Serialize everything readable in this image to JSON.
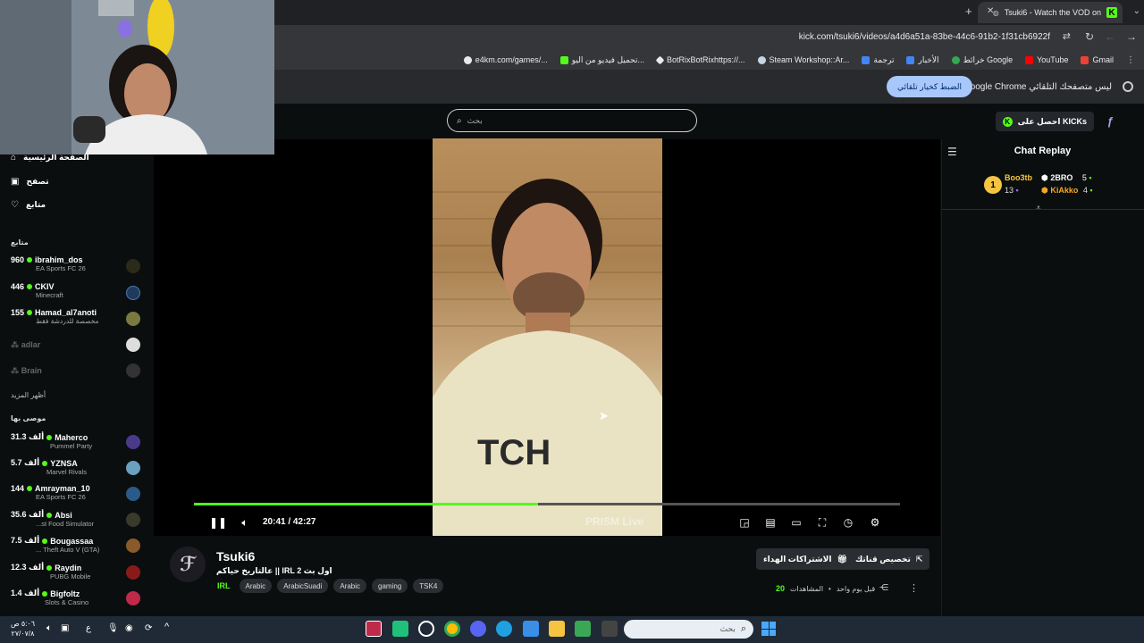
{
  "browser": {
    "tab_title": "Tsuki6 - Watch the VOD on",
    "url": "kick.com/tsuki6/videos/a4d6a51a-83be-44c6-91b2-1f31cb6922f",
    "bookmarks": [
      {
        "label": "Gmail",
        "color": "#ea4335"
      },
      {
        "label": "YouTube",
        "color": "#ff0000"
      },
      {
        "label": "خرائط Google",
        "color": "#34a853"
      },
      {
        "label": "الأخبار",
        "color": "#4285f4"
      },
      {
        "label": "ترجمة",
        "color": "#4285f4"
      },
      {
        "label": "Steam Workshop::Ar...",
        "color": "#c7d5e0"
      },
      {
        "label": "BotRixBotRixhttps://...",
        "color": "#e8eaed"
      },
      {
        "label": "تحميل فيديو من اليو...",
        "color": "#53fc18"
      },
      {
        "label": "e4km.com/games/...",
        "color": "#e8eaed"
      }
    ],
    "infobar_text": "Google Chrome ليس متصفحك التلقائي",
    "infobar_button": "الضبط كخيار تلقائي"
  },
  "kick": {
    "search_placeholder": "بحث",
    "kicks_button": "احصل على KICKs",
    "nav": [
      {
        "label": "الصفحة الرئيسية",
        "icon": "home-icon"
      },
      {
        "label": "تصفح",
        "icon": "browse-icon"
      },
      {
        "label": "متابع",
        "icon": "heart-icon"
      }
    ],
    "following_title": "متابع",
    "following": [
      {
        "count": "960",
        "name": "ibrahim_dos",
        "game": "EA Sports FC 26",
        "live": true
      },
      {
        "count": "446",
        "name": "CKIV",
        "game": "Minecraft",
        "live": true
      },
      {
        "count": "155",
        "name": "Hamad_al7anoti",
        "game": "مخصصة للدردشة فقط",
        "live": true
      },
      {
        "count": "",
        "name": "adlar",
        "game": "",
        "live": false
      },
      {
        "count": "",
        "name": "Brain",
        "game": "",
        "live": false
      }
    ],
    "show_more": "أظهر المزيد",
    "recommended_title": "موصى بها",
    "recommended": [
      {
        "count": "31.3 ألف",
        "name": "Maherco",
        "game": "Pummel Party"
      },
      {
        "count": "5.7 ألف",
        "name": "YZNSA",
        "game": "Marvel Rivals"
      },
      {
        "count": "144",
        "name": "Amrayman_10",
        "game": "EA Sports FC 26"
      },
      {
        "count": "35.6 ألف",
        "name": "Absi",
        "game": "...st Food Simulator"
      },
      {
        "count": "7.5 ألف",
        "name": "Bougassaa",
        "game": "... Theft Auto V (GTA)"
      },
      {
        "count": "12.3 ألف",
        "name": "Raydin",
        "game": "PUBG Mobile"
      },
      {
        "count": "1.4 ألف",
        "name": "Bigfoltz",
        "game": "Slots & Casino"
      }
    ],
    "player": {
      "time": "20:41 / 42:27",
      "progress": 0.487,
      "watermark": "PRISM Live"
    },
    "stream": {
      "streamer": "Tsuki6",
      "title": "عالتاريخ حياكم || IRL 2 اول بث",
      "category": "IRL",
      "tags": [
        "Arabic",
        "ArabicSuadi",
        "Arabic",
        "gaming",
        "TSK4"
      ],
      "customize_button": "تخصيص قناتك",
      "gift_button": "الاشتراكات الهداء",
      "views_label": "المشاهدات",
      "views_count": "20",
      "posted": "قبل يوم واحد"
    },
    "chat": {
      "title": "Chat Replay",
      "leaderboard": [
        {
          "name": "2BRO",
          "value": "5",
          "color": "#ffffff"
        },
        {
          "name": "Boo3tb",
          "value": "13",
          "color": "#f5c542"
        },
        {
          "name": "KiAkko",
          "value": "4",
          "color": "#f5a623"
        }
      ],
      "rank_badge": "1"
    }
  },
  "taskbar": {
    "clock_time": "٥:٠٦ ص",
    "clock_date": "٢٧/٠٧/٨",
    "lang": "ع",
    "search_placeholder": "بحث"
  }
}
